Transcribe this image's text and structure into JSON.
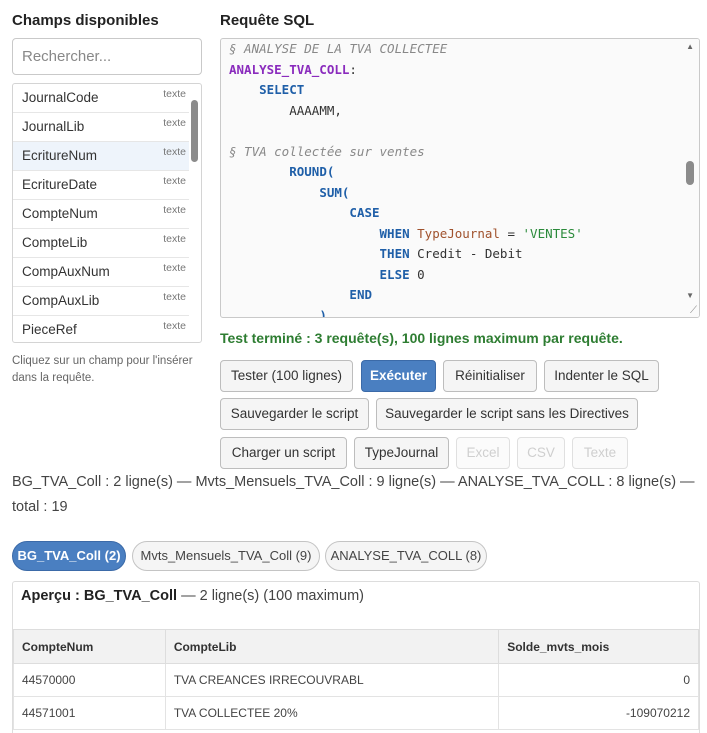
{
  "left_panel": {
    "title": "Champs disponibles",
    "search_placeholder": "Rechercher...",
    "fields": [
      {
        "name": "JournalCode",
        "type": "texte"
      },
      {
        "name": "JournalLib",
        "type": "texte"
      },
      {
        "name": "EcritureNum",
        "type": "texte"
      },
      {
        "name": "EcritureDate",
        "type": "texte"
      },
      {
        "name": "CompteNum",
        "type": "texte"
      },
      {
        "name": "CompteLib",
        "type": "texte"
      },
      {
        "name": "CompAuxNum",
        "type": "texte"
      },
      {
        "name": "CompAuxLib",
        "type": "texte"
      },
      {
        "name": "PieceRef",
        "type": "texte"
      }
    ],
    "hint": "Cliquez sur un champ pour l'insérer dans la requête."
  },
  "editor": {
    "title": "Requête SQL",
    "lines": [
      {
        "indent": "",
        "parts": [
          {
            "t": "§ ANALYSE DE LA TVA COLLECTEE",
            "c": "comment"
          }
        ]
      },
      {
        "indent": "",
        "parts": [
          {
            "t": "ANALYSE_TVA_COLL",
            "c": "label"
          },
          {
            "t": ":",
            "c": ""
          }
        ]
      },
      {
        "indent": "    ",
        "parts": [
          {
            "t": "SELECT",
            "c": "kw"
          }
        ]
      },
      {
        "indent": "        ",
        "parts": [
          {
            "t": "AAAAMM,",
            "c": ""
          }
        ]
      },
      {
        "indent": "",
        "parts": []
      },
      {
        "indent": "",
        "parts": [
          {
            "t": "§ TVA collectée sur ventes",
            "c": "comment"
          }
        ]
      },
      {
        "indent": "        ",
        "parts": [
          {
            "t": "ROUND(",
            "c": "kw"
          }
        ]
      },
      {
        "indent": "            ",
        "parts": [
          {
            "t": "SUM(",
            "c": "kw"
          }
        ]
      },
      {
        "indent": "                ",
        "parts": [
          {
            "t": "CASE",
            "c": "kw"
          }
        ]
      },
      {
        "indent": "                    ",
        "parts": [
          {
            "t": "WHEN",
            "c": "kw"
          },
          {
            "t": " ",
            "c": ""
          },
          {
            "t": "TypeJournal",
            "c": "ident"
          },
          {
            "t": " = ",
            "c": ""
          },
          {
            "t": "'VENTES'",
            "c": "str"
          }
        ]
      },
      {
        "indent": "                    ",
        "parts": [
          {
            "t": "THEN",
            "c": "kw"
          },
          {
            "t": " Credit - Debit",
            "c": ""
          }
        ]
      },
      {
        "indent": "                    ",
        "parts": [
          {
            "t": "ELSE",
            "c": "kw"
          },
          {
            "t": " 0",
            "c": ""
          }
        ]
      },
      {
        "indent": "                ",
        "parts": [
          {
            "t": "END",
            "c": "kw"
          }
        ]
      },
      {
        "indent": "            ",
        "parts": [
          {
            "t": "),",
            "c": "kw"
          }
        ]
      }
    ]
  },
  "status": "Test terminé : 3 requête(s), 100 lignes maximum par requête.",
  "buttons": {
    "test": "Tester (100 lignes)",
    "execute": "Exécuter",
    "reset": "Réinitialiser",
    "indent": "Indenter le SQL",
    "save": "Sauvegarder le script",
    "save_no_directives": "Sauvegarder le script sans les Directives",
    "load": "Charger un script",
    "typejournal": "TypeJournal",
    "excel": "Excel",
    "csv": "CSV",
    "text": "Texte"
  },
  "summary": "BG_TVA_Coll : 2 ligne(s) — Mvts_Mensuels_TVA_Coll : 9 ligne(s) — ANALYSE_TVA_COLL : 8 ligne(s) — total : 19",
  "result_tabs": [
    "BG_TVA_Coll (2)",
    "Mvts_Mensuels_TVA_Coll (9)",
    "ANALYSE_TVA_COLL (8)"
  ],
  "preview": {
    "prefix": "Aperçu : ",
    "name": "BG_TVA_Coll",
    "suffix": " — 2 ligne(s) (100 maximum)",
    "columns": [
      "CompteNum",
      "CompteLib",
      "Solde_mvts_mois"
    ],
    "rows": [
      [
        "44570000",
        "TVA CREANCES IRRECOUVRABL",
        "0"
      ],
      [
        "44571001",
        "TVA COLLECTEE 20%",
        "-109070212"
      ]
    ]
  }
}
